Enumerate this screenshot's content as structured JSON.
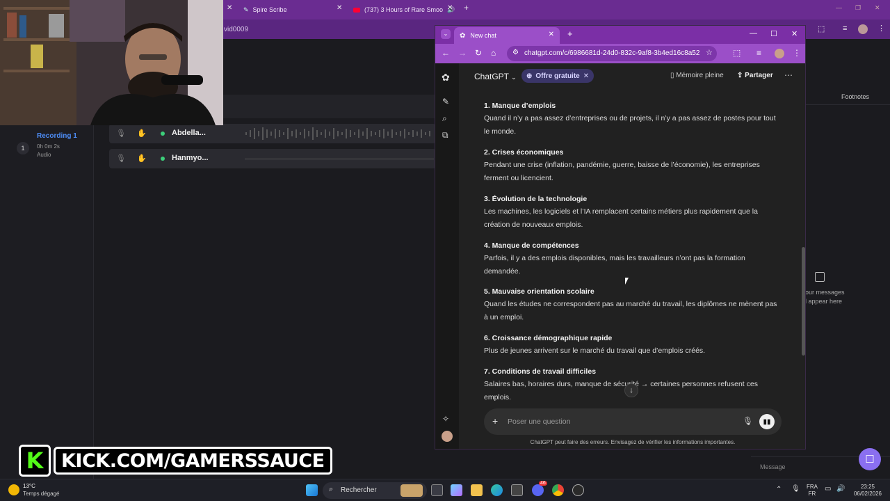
{
  "background_app": {
    "tabs": [
      {
        "label": "Spire Scribe"
      },
      {
        "label": "(737) 3 Hours of Rare Smoo"
      }
    ],
    "address_fragment": "vid0009",
    "recording": {
      "number": "1",
      "title": "Recording 1",
      "duration": "0h 0m 2s",
      "type": "Audio"
    },
    "tracks": [
      {
        "name": "Abdella..."
      },
      {
        "name": "Hanmyo..."
      }
    ],
    "footnotes_label": "Footnotes",
    "empty_messages": [
      "our messages",
      "l appear here"
    ],
    "message_placeholder": "Message"
  },
  "kick_banner": {
    "letter": "K",
    "text": "KICK.COM/GAMERSSAUCE"
  },
  "browser": {
    "tab_title": "New chat",
    "url": "chatgpt.com/c/6986681d-24d0-832c-9af8-3b4ed16c8a52"
  },
  "chatgpt": {
    "model": "ChatGPT",
    "plan_badge": "Offre gratuite",
    "memory_label": "Mémoire pleine",
    "share_label": "Partager",
    "sections": [
      {
        "title": "1. Manque d’emplois",
        "body": "Quand il n’y a pas assez d’entreprises ou de projets, il n’y a pas assez de postes pour tout le monde."
      },
      {
        "title": "2. Crises économiques",
        "body": "Pendant une crise (inflation, pandémie, guerre, baisse de l’économie), les entreprises ferment ou licencient."
      },
      {
        "title": "3. Évolution de la technologie",
        "body": "Les machines, les logiciels et l’IA remplacent certains métiers plus rapidement que la création de nouveaux emplois."
      },
      {
        "title": "4. Manque de compétences",
        "body": "Parfois, il y a des emplois disponibles, mais les travailleurs n’ont pas la formation demandée."
      },
      {
        "title": "5. Mauvaise orientation scolaire",
        "body": "Quand les études ne correspondent pas au marché du travail, les diplômes ne mènent pas à un emploi."
      },
      {
        "title": "6. Croissance démographique rapide",
        "body": "Plus de jeunes arrivent sur le marché du travail que d’emplois créés."
      },
      {
        "title": "7. Conditions de travail difficiles",
        "body": "Salaires bas, horaires durs, manque de sécurité → certaines personnes refusent ces emplois."
      }
    ],
    "composer_placeholder": "Poser une question",
    "disclaimer": "ChatGPT peut faire des erreurs. Envisagez de vérifier les informations importantes."
  },
  "taskbar": {
    "weather_temp": "13°C",
    "weather_desc": "Temps dégagé",
    "search_label": "Rechercher",
    "lang_top": "FRA",
    "lang_bottom": "FR",
    "time": "23:25",
    "date": "06/02/2026",
    "discord_badge": "46"
  },
  "colors": {
    "browser_purple": "#9b4fc8",
    "chat_bg": "#212121",
    "kick_green": "#53fc18",
    "accent_blue": "#4d8cf5"
  }
}
